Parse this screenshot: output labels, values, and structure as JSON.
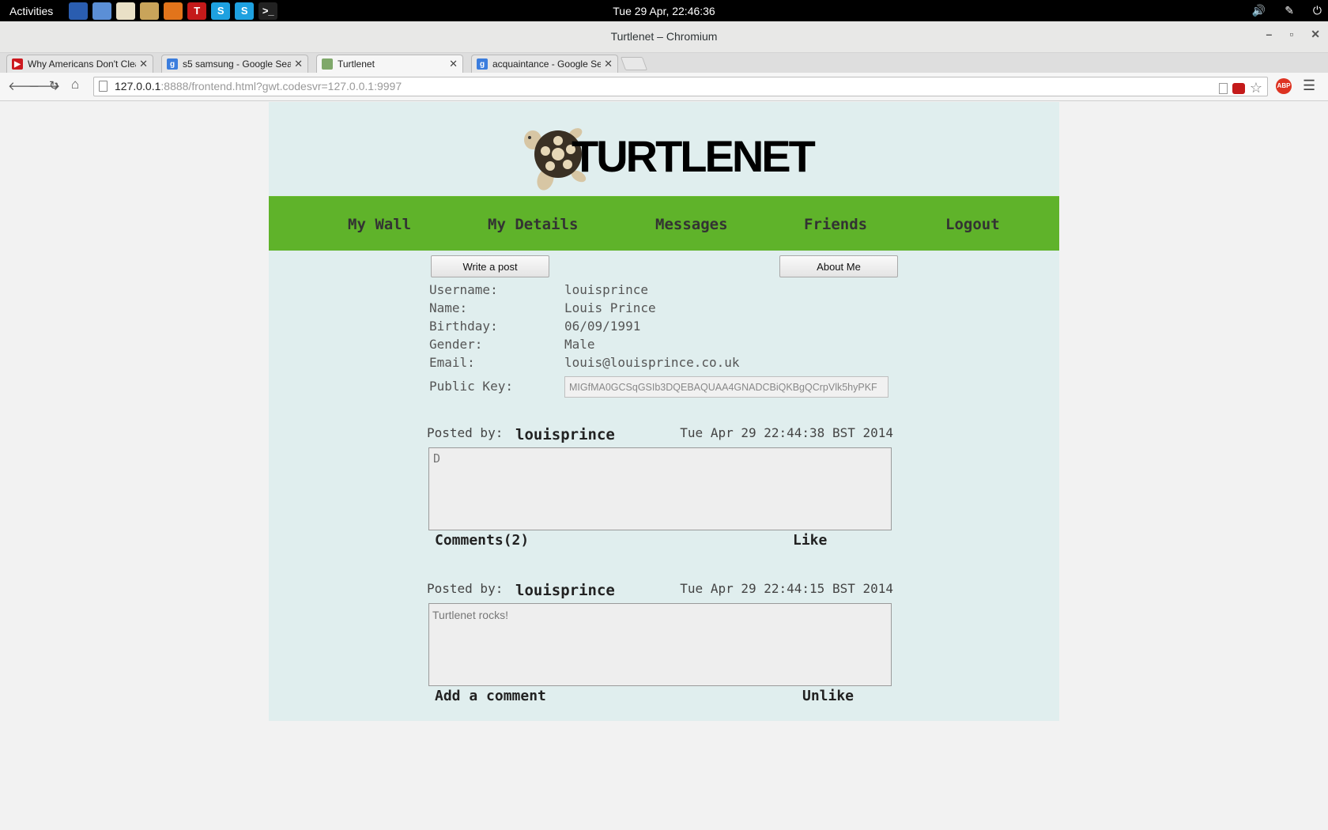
{
  "topbar": {
    "activities": "Activities",
    "clock": "Tue 29 Apr, 22:46:36",
    "launchers": [
      {
        "name": "terminal-monitor-icon",
        "color": "#2a5db0",
        "glyph": ""
      },
      {
        "name": "chromium-icon",
        "color": "#5b8fd6",
        "glyph": ""
      },
      {
        "name": "text-editor-icon",
        "color": "#e9e0c6",
        "glyph": ""
      },
      {
        "name": "files-icon",
        "color": "#c9a45a",
        "glyph": ""
      },
      {
        "name": "firefox-icon",
        "color": "#e2741b",
        "glyph": ""
      },
      {
        "name": "turtle-app-icon",
        "color": "#c41a1a",
        "glyph": "T"
      },
      {
        "name": "skype-icon",
        "color": "#1ea1e0",
        "glyph": "S"
      },
      {
        "name": "skype-icon-2",
        "color": "#1ea1e0",
        "glyph": "S"
      },
      {
        "name": "shell-icon",
        "color": "#222222",
        "glyph": ">_"
      }
    ],
    "volume_icon": "🔊",
    "network_icon": "✎",
    "power_icon": "⏻"
  },
  "window": {
    "title": "Turtlenet – Chromium",
    "minimize": "–",
    "maximize": "▫",
    "close": "✕"
  },
  "tabs": [
    {
      "title": "Why Americans Don't Clea",
      "fav_color": "#cc181e",
      "fav_glyph": "▶",
      "close": "✕"
    },
    {
      "title": "s5 samsung - Google Sear",
      "fav_color": "#3b7ddd",
      "fav_glyph": "g",
      "close": "✕"
    },
    {
      "title": "Turtlenet",
      "fav_color": "#7fa86a",
      "fav_glyph": "",
      "close": "✕"
    },
    {
      "title": "acquaintance - Google Sea",
      "fav_color": "#3b7ddd",
      "fav_glyph": "g",
      "close": "✕"
    }
  ],
  "toolbar": {
    "back": "🡐",
    "forward": "🡒",
    "reload": "↻",
    "home": "⌂",
    "url_host": "127.0.0.1",
    "url_rest": ":8888/frontend.html?gwt.codesvr=127.0.0.1:9997",
    "bookmark_star": "☆",
    "adblock": "ABP",
    "menu": "☰"
  },
  "site": {
    "logo_text": "TURTLENET",
    "nav": [
      "My Wall",
      "My Details",
      "Messages",
      "Friends",
      "Logout"
    ],
    "write_post": "Write a post",
    "about_me": "About Me",
    "details": {
      "username_label": "Username:",
      "username": "louisprince",
      "name_label": "Name:",
      "name": "Louis Prince",
      "birthday_label": "Birthday:",
      "birthday": "06/09/1991",
      "gender_label": "Gender:",
      "gender": "Male",
      "email_label": "Email:",
      "email": "louis@louisprince.co.uk",
      "pkey_label": "Public Key:",
      "pkey": "MIGfMA0GCSqGSIb3DQEBAQUAA4GNADCBiQKBgQCrpVlk5hyPKF"
    },
    "posts": [
      {
        "posted_by": "Posted by:",
        "user": "louisprince",
        "date": "Tue Apr 29 22:44:38 BST 2014",
        "body": "D",
        "left_action": "Comments(2)",
        "right_action": "Like"
      },
      {
        "posted_by": "Posted by:",
        "user": "louisprince",
        "date": "Tue Apr 29 22:44:15 BST 2014",
        "body": "Turtlenet rocks!",
        "left_action": "Add a comment",
        "right_action": "Unlike"
      }
    ]
  }
}
